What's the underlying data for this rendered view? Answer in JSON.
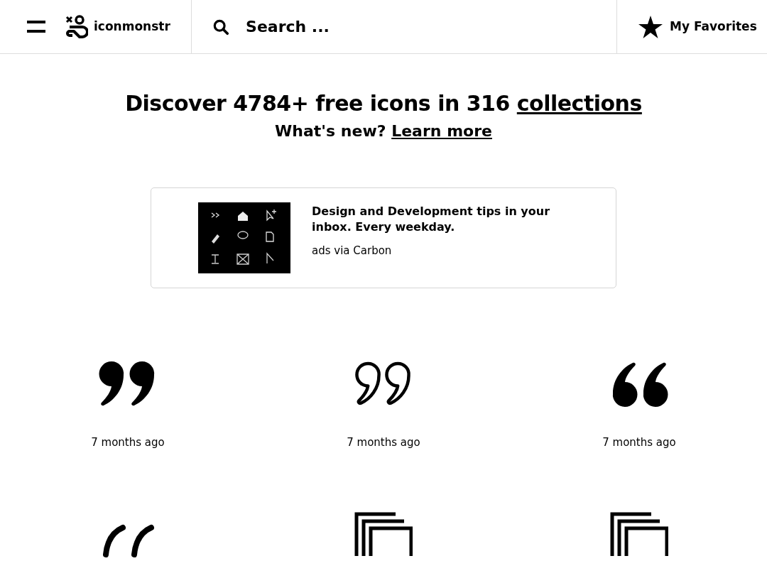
{
  "header": {
    "logo_text": "iconmonstr",
    "search": {
      "placeholder": "Search ..."
    },
    "favorites": "My Favorites"
  },
  "hero": {
    "headline": "Discover 4784+ free icons in 316",
    "headline_link": "collections",
    "subline": "What's new?",
    "subline_link": "Learn more"
  },
  "ad": {
    "kind": "picture",
    "text": "Design and Development tips in your inbox. Every weekday.",
    "source": "ads via Carbon"
  },
  "icons": [
    {
      "kind": "quote-close-filled",
      "caption": "7 months ago"
    },
    {
      "kind": "quote-close-outline",
      "caption": "7 months ago"
    },
    {
      "kind": "quote-open-filled",
      "caption": "7 months ago"
    },
    {
      "kind": "quote-open-slanted"
    },
    {
      "kind": "stack"
    },
    {
      "kind": "stack"
    }
  ]
}
